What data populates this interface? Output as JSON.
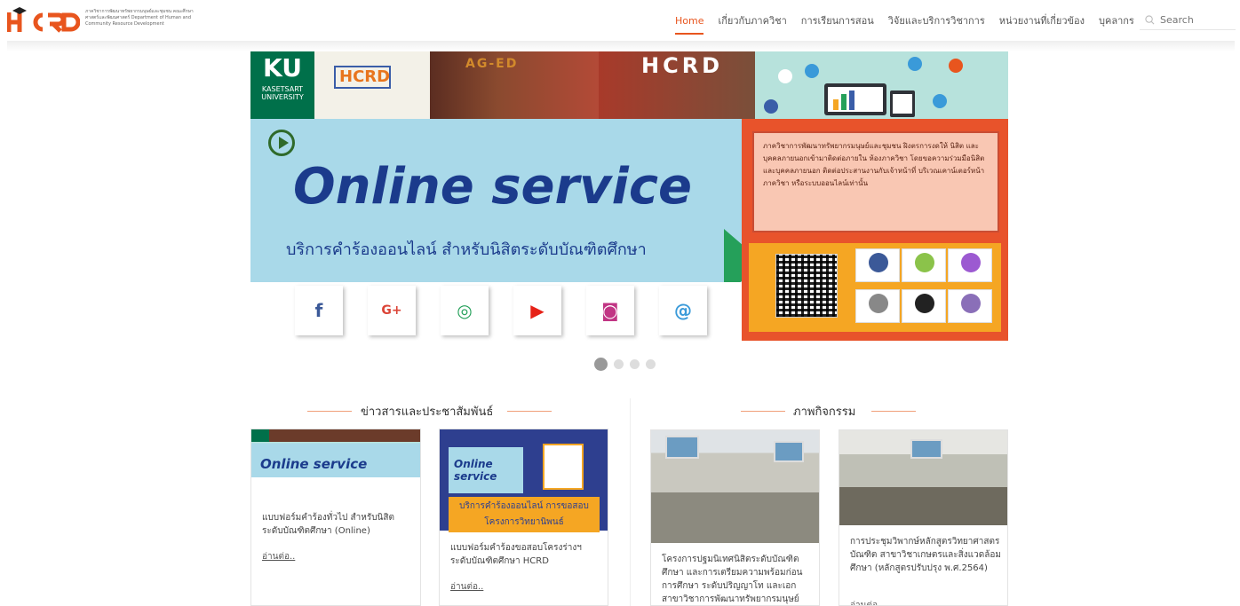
{
  "header": {
    "logo_text": "HCRD",
    "logo_sub": "ภาควิชาการพัฒนาทรัพยากรมนุษย์และชุมชน คณะศึกษาศาสตร์และพัฒนศาสตร์ Department of Human and Community Resource Development",
    "nav": [
      "Home",
      "เกี่ยวกับภาควิชา",
      "การเรียนการสอน",
      "วิจัยและบริการวิชาการ",
      "หน่วยงานที่เกี่ยวข้อง",
      "บุคลากร"
    ],
    "search_placeholder": "Search",
    "accent": "#e8551e"
  },
  "banner": {
    "ku": "KU",
    "ku_sub": "KASETSART UNIVERSITY",
    "hcrd": "HCRD",
    "photo1_text": "AG-ED",
    "photo2_text": "HCRD",
    "online": "Online service",
    "subtitle": "บริการคำร้องออนไลน์ สำหรับนิสิตระดับบัณฑิตศึกษา",
    "notice": "ภาควิชาการพัฒนาทรัพยากรมนุษย์และชุมชน ฝิงตรการงดให้ นิสิต และบุคคลภายนอกเข้ามาติดต่อภายใน ห้องภาควิชา โดยขอความร่วมมือนิสิต และบุคคลภายนอก ติดต่อประสานงานกับเจ้าหน้าที่ บริเวณเคาน์เตอร์หน้าภาควิชา หรือระบบออนไลน์เท่านั้น",
    "slides_total": 4,
    "slide_active": 1
  },
  "news": {
    "title": "ข่าวสารและประชาสัมพันธ์",
    "items": [
      {
        "caption": "แบบฟอร์มคำร้องทั่วไป สำหรับนิสิตระดับบัณฑิตศึกษา (Online)",
        "more": "อ่านต่อ..",
        "thumb_title": "Online service"
      },
      {
        "caption": "แบบฟอร์มคำร้องขอสอบโครงร่างฯ ระดับบัณฑิตศึกษา HCRD",
        "more": "อ่านต่อ..",
        "thumb_title": "Online service",
        "thumb_band": "บริการคำร้องออนไลน์ การขอสอบโครงการวิทยานิพนธ์"
      }
    ]
  },
  "activities": {
    "title": "ภาพกิจกรรม",
    "items": [
      {
        "caption": "โครงการปฐมนิเทศนิสิตระดับบัณฑิตศึกษา และการเตรียมความพร้อมก่อนการศึกษา ระดับปริญญาโท และเอก สาขาวิชาการพัฒนาทรัพยากรมนุษย์"
      },
      {
        "caption": "การประชุมวิพากษ์หลักสูตรวิทยาศาสตรบัณฑิต สาขาวิชาเกษตรและสิ่งแวดล้อมศึกษา (หลักสูตรปรับปรุง พ.ศ.2564)",
        "more": "อ่านต่อ.."
      }
    ]
  }
}
